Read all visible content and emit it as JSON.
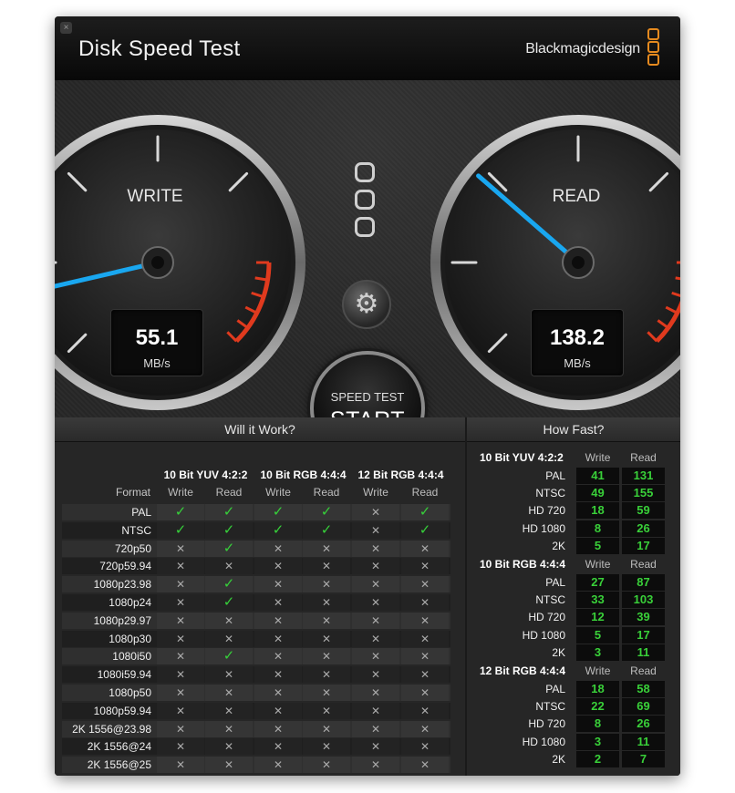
{
  "window": {
    "title": "Disk Speed Test",
    "brand": "Blackmagicdesign",
    "close_glyph": "×"
  },
  "gauges": {
    "write": {
      "label": "WRITE",
      "value": "55.1",
      "unit": "MB/s"
    },
    "read": {
      "label": "READ",
      "value": "138.2",
      "unit": "MB/s"
    }
  },
  "controls": {
    "settings_icon": "gear-icon",
    "settings_glyph": "⚙",
    "start_small": "SPEED TEST",
    "start_big": "START"
  },
  "colors": {
    "needle": "#19a7f0",
    "redline": "#e03a1e",
    "check": "#36d03a",
    "number": "#39d039",
    "brand_accent": "#e58a1f"
  },
  "will_it_work": {
    "title": "Will it Work?",
    "format_header": "Format",
    "groups": [
      {
        "name": "10 Bit YUV 4:2:2",
        "cols": [
          "Write",
          "Read"
        ]
      },
      {
        "name": "10 Bit RGB 4:4:4",
        "cols": [
          "Write",
          "Read"
        ]
      },
      {
        "name": "12 Bit RGB 4:4:4",
        "cols": [
          "Write",
          "Read"
        ]
      }
    ],
    "check_glyph": "✓",
    "cross_glyph": "✕",
    "rows": [
      {
        "format": "PAL",
        "cells": [
          1,
          1,
          1,
          1,
          0,
          1
        ]
      },
      {
        "format": "NTSC",
        "cells": [
          1,
          1,
          1,
          1,
          0,
          1
        ]
      },
      {
        "format": "720p50",
        "cells": [
          0,
          1,
          0,
          0,
          0,
          0
        ]
      },
      {
        "format": "720p59.94",
        "cells": [
          0,
          0,
          0,
          0,
          0,
          0
        ]
      },
      {
        "format": "1080p23.98",
        "cells": [
          0,
          1,
          0,
          0,
          0,
          0
        ]
      },
      {
        "format": "1080p24",
        "cells": [
          0,
          1,
          0,
          0,
          0,
          0
        ]
      },
      {
        "format": "1080p29.97",
        "cells": [
          0,
          0,
          0,
          0,
          0,
          0
        ]
      },
      {
        "format": "1080p30",
        "cells": [
          0,
          0,
          0,
          0,
          0,
          0
        ]
      },
      {
        "format": "1080i50",
        "cells": [
          0,
          1,
          0,
          0,
          0,
          0
        ]
      },
      {
        "format": "1080i59.94",
        "cells": [
          0,
          0,
          0,
          0,
          0,
          0
        ]
      },
      {
        "format": "1080p50",
        "cells": [
          0,
          0,
          0,
          0,
          0,
          0
        ]
      },
      {
        "format": "1080p59.94",
        "cells": [
          0,
          0,
          0,
          0,
          0,
          0
        ]
      },
      {
        "format": "2K 1556@23.98",
        "cells": [
          0,
          0,
          0,
          0,
          0,
          0
        ]
      },
      {
        "format": "2K 1556@24",
        "cells": [
          0,
          0,
          0,
          0,
          0,
          0
        ]
      },
      {
        "format": "2K 1556@25",
        "cells": [
          0,
          0,
          0,
          0,
          0,
          0
        ]
      }
    ]
  },
  "how_fast": {
    "title": "How Fast?",
    "groups": [
      {
        "name": "10 Bit YUV 4:2:2",
        "cols": [
          "Write",
          "Read"
        ],
        "rows": [
          {
            "label": "PAL",
            "write": "41",
            "read": "131"
          },
          {
            "label": "NTSC",
            "write": "49",
            "read": "155"
          },
          {
            "label": "HD 720",
            "write": "18",
            "read": "59"
          },
          {
            "label": "HD 1080",
            "write": "8",
            "read": "26"
          },
          {
            "label": "2K",
            "write": "5",
            "read": "17"
          }
        ]
      },
      {
        "name": "10 Bit RGB 4:4:4",
        "cols": [
          "Write",
          "Read"
        ],
        "rows": [
          {
            "label": "PAL",
            "write": "27",
            "read": "87"
          },
          {
            "label": "NTSC",
            "write": "33",
            "read": "103"
          },
          {
            "label": "HD 720",
            "write": "12",
            "read": "39"
          },
          {
            "label": "HD 1080",
            "write": "5",
            "read": "17"
          },
          {
            "label": "2K",
            "write": "3",
            "read": "11"
          }
        ]
      },
      {
        "name": "12 Bit RGB 4:4:4",
        "cols": [
          "Write",
          "Read"
        ],
        "rows": [
          {
            "label": "PAL",
            "write": "18",
            "read": "58"
          },
          {
            "label": "NTSC",
            "write": "22",
            "read": "69"
          },
          {
            "label": "HD 720",
            "write": "8",
            "read": "26"
          },
          {
            "label": "HD 1080",
            "write": "3",
            "read": "11"
          },
          {
            "label": "2K",
            "write": "2",
            "read": "7"
          }
        ]
      }
    ]
  }
}
